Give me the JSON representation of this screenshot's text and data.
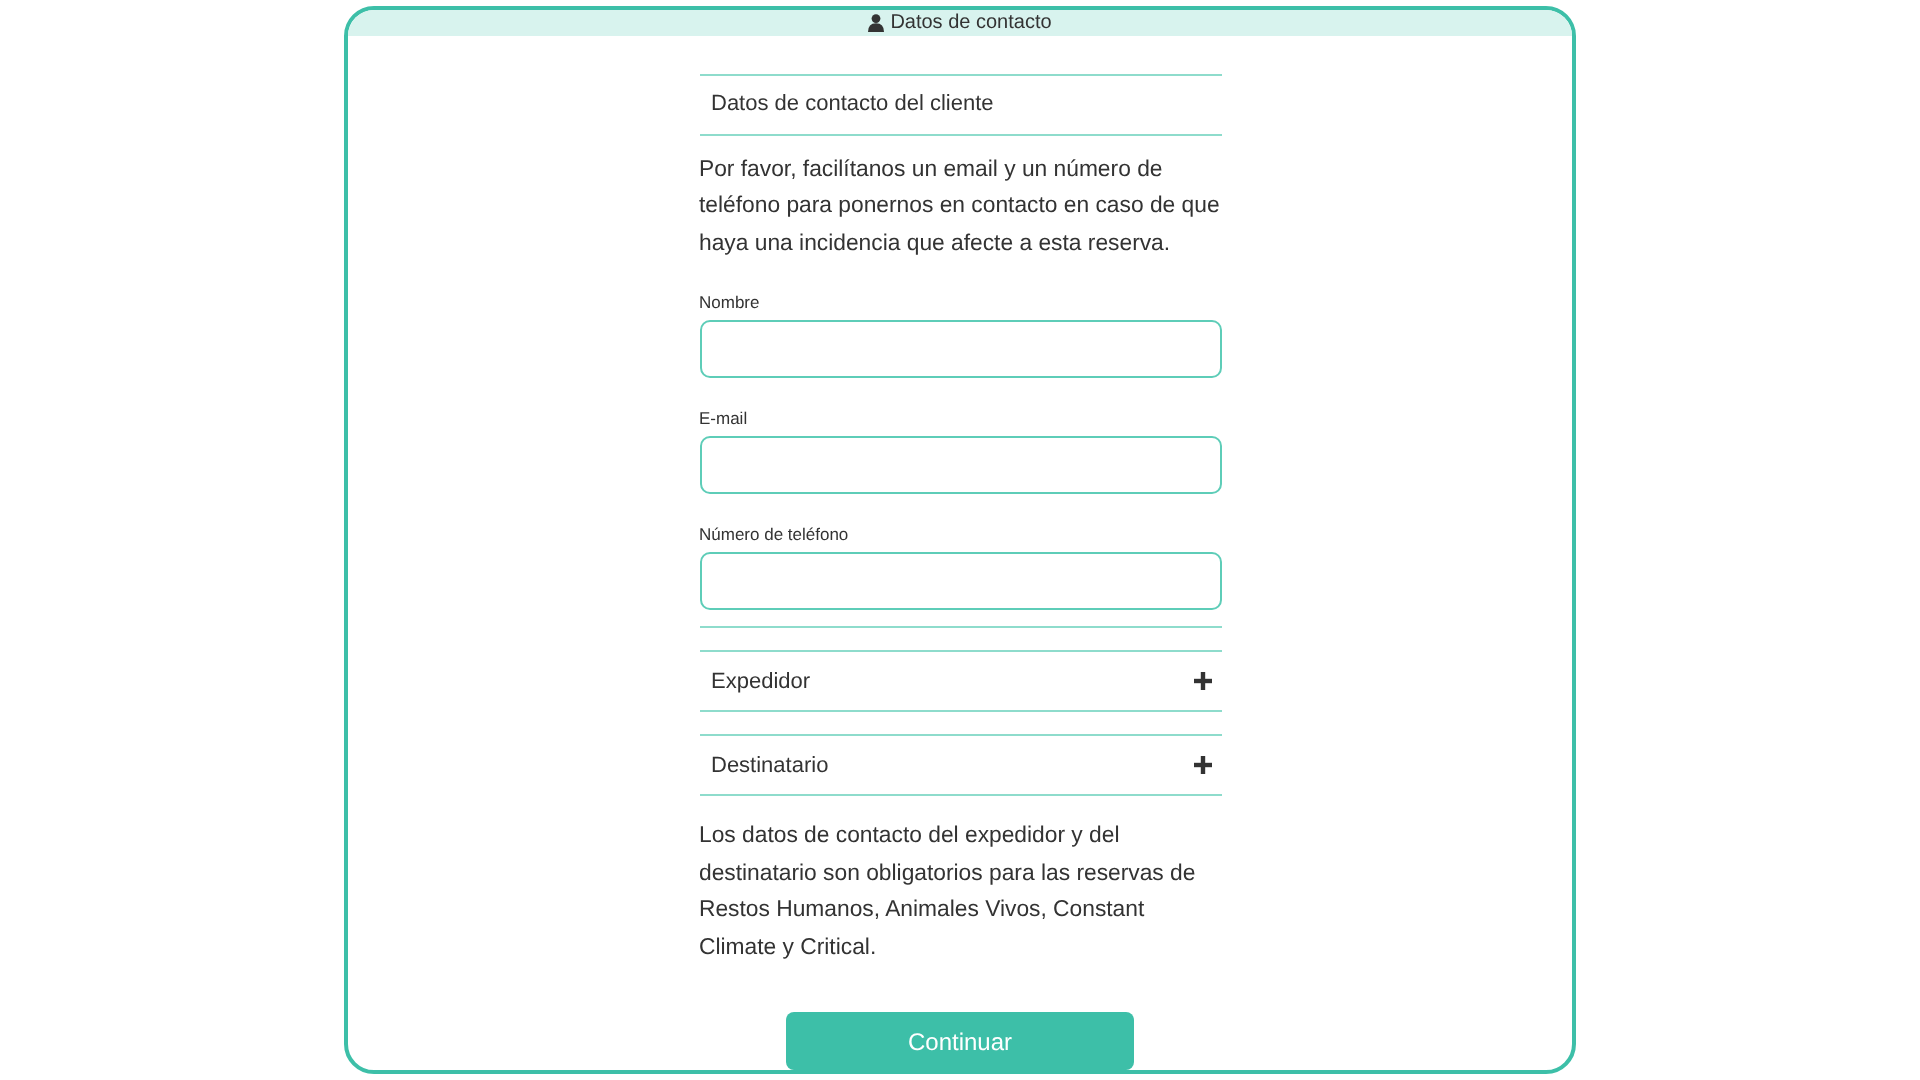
{
  "header": {
    "title": "Datos de contacto"
  },
  "section_title": "Datos de contacto del cliente",
  "intro": "Por favor, facilítanos un email y un número de teléfono para ponernos en contacto en caso de que haya una incidencia que afecte a esta reserva.",
  "fields": [
    {
      "label": "Nombre"
    },
    {
      "label": "E-mail"
    },
    {
      "label": "Número de teléfono"
    }
  ],
  "panels": [
    {
      "title": "Expedidor",
      "expanded": false
    },
    {
      "title": "Destinatario",
      "expanded": false
    }
  ],
  "note": "Los datos de contacto del expedidor y del destinatario son obligatorios para las reservas de Restos Humanos, Animales Vivos, Constant Climate y Critical.",
  "button": "Continuar"
}
